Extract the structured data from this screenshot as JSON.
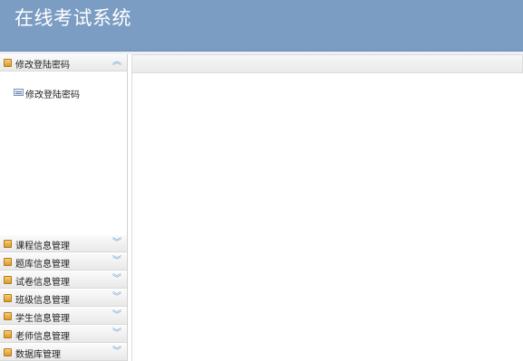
{
  "app": {
    "title": "在线考试系统"
  },
  "sidebar": {
    "expanded_panel": {
      "label": "修改登陆密码",
      "chevron": "︽",
      "items": [
        {
          "label": "修改登陆密码"
        }
      ]
    },
    "panels": [
      {
        "label": "课程信息管理",
        "chevron": "︾"
      },
      {
        "label": "题库信息管理",
        "chevron": "︾"
      },
      {
        "label": "试卷信息管理",
        "chevron": "︾"
      },
      {
        "label": "班级信息管理",
        "chevron": "︾"
      },
      {
        "label": "学生信息管理",
        "chevron": "︾"
      },
      {
        "label": "老师信息管理",
        "chevron": "︾"
      },
      {
        "label": "数据库管理",
        "chevron": "︾"
      }
    ]
  },
  "colors": {
    "header_bg": "#7b9dc3",
    "chevron": "#6a9fd6",
    "folder": "#e0a53a"
  }
}
